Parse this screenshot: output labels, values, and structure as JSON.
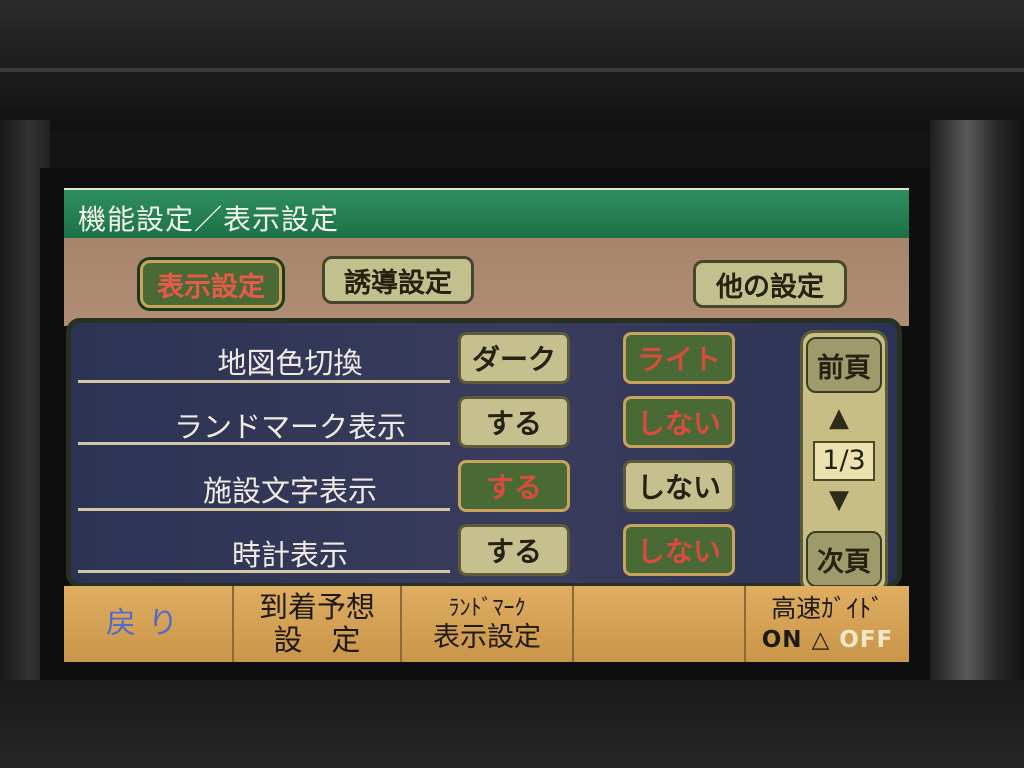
{
  "title": "機能設定／表示設定",
  "tabs": {
    "display": "表示設定",
    "guidance": "誘導設定",
    "other": "他の設定"
  },
  "settings": [
    {
      "label": "地図色切換",
      "option1": "ダーク",
      "option2": "ライト"
    },
    {
      "label": "ランドマーク表示",
      "option1": "する",
      "option2": "しない"
    },
    {
      "label": "施設文字表示",
      "option1": "する",
      "option2": "しない"
    },
    {
      "label": "時計表示",
      "option1": "する",
      "option2": "しない"
    }
  ],
  "pager": {
    "prev": "前頁",
    "page": "1/3",
    "next": "次頁",
    "up_arrow": "▲",
    "down_arrow": "▼"
  },
  "bottom": {
    "back": "戻り",
    "arrival_line1": "到着予想",
    "arrival_line2": "設　定",
    "landmark_line1": "ﾗﾝﾄﾞﾏｰｸ",
    "landmark_line2": "表示設定",
    "highway_line1": "高速ｶﾞｲﾄﾞ",
    "highway_on": "ON",
    "highway_off": "OFF"
  },
  "colors": {
    "title_bar": "#1c7046",
    "panel": "#2c3354",
    "button": "#c5c08e",
    "selected_button": "#4a6a35",
    "selected_text": "#d84c3e",
    "bottom_bar": "#c99548"
  }
}
